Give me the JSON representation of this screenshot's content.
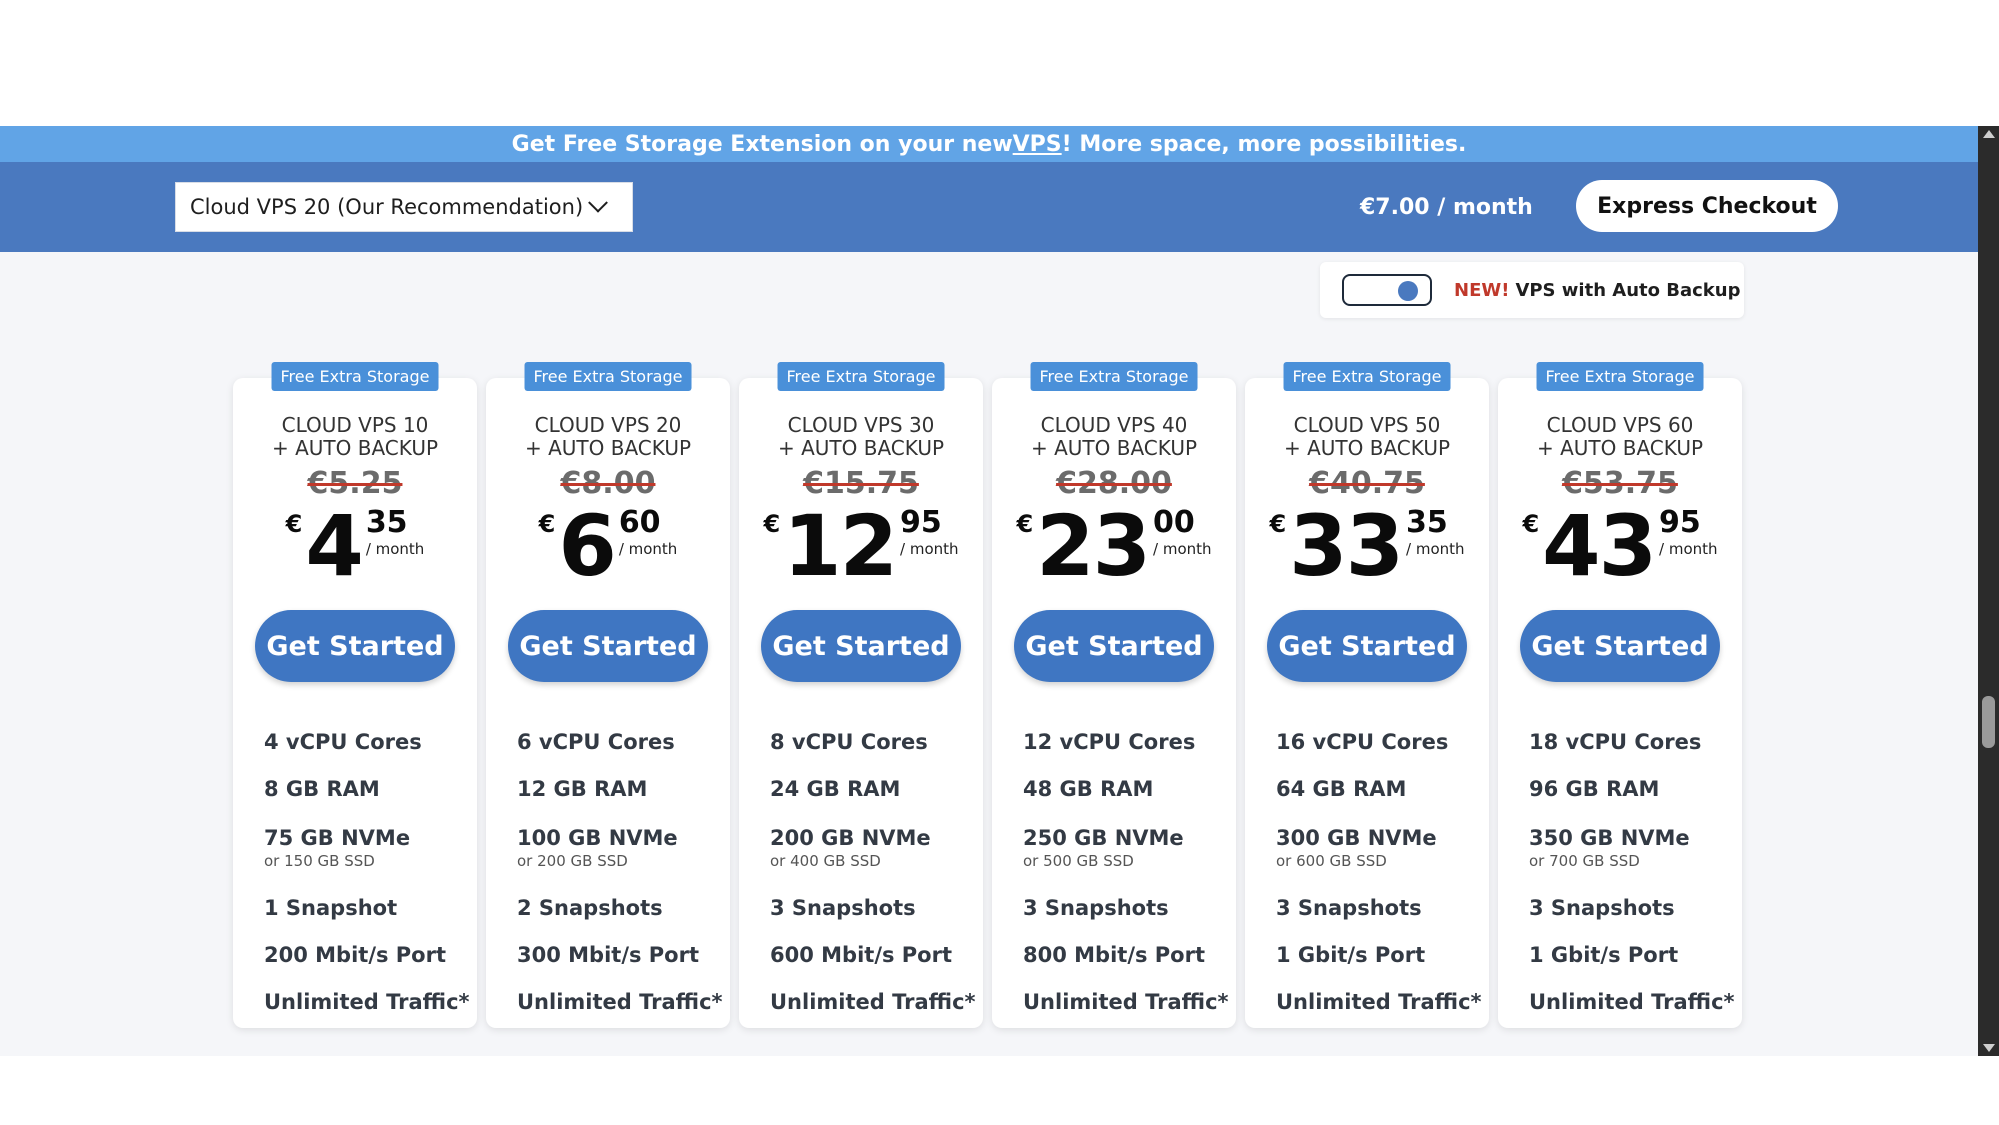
{
  "promo": {
    "text_before": "Get Free Storage Extension on your new ",
    "link_text": "VPS",
    "text_after": "! More space, more possibilities."
  },
  "selector": {
    "selected_value": "Cloud VPS 20 (Our Recommendation)",
    "price": "€7.00 / month",
    "checkout_label": "Express Checkout"
  },
  "toggle": {
    "new_label": "NEW!",
    "label": "VPS with Auto Backup",
    "state": "on"
  },
  "colors": {
    "accent": "#4a79bf",
    "promo_bg": "#61a4e6",
    "button": "#3f76c2",
    "badge": "#4a90d9",
    "strike": "#c0392b"
  },
  "plans": [
    {
      "badge": "Free Extra Storage",
      "name_line1": "CLOUD VPS 10",
      "name_line2": "+ AUTO BACKUP",
      "old_price": "€5.25",
      "currency": "€",
      "price_main": "4",
      "price_cents": "35",
      "per": "/ month",
      "cta": "Get Started",
      "cpu": "4 vCPU Cores",
      "ram": "8 GB RAM",
      "storage": "75 GB NVMe",
      "storage_alt": "or 150 GB SSD",
      "snapshots": "1 Snapshot",
      "port": "200 Mbit/s Port",
      "traffic": "Unlimited Traffic*"
    },
    {
      "badge": "Free Extra Storage",
      "name_line1": "CLOUD VPS 20",
      "name_line2": "+ AUTO BACKUP",
      "old_price": "€8.00",
      "currency": "€",
      "price_main": "6",
      "price_cents": "60",
      "per": "/ month",
      "cta": "Get Started",
      "cpu": "6 vCPU Cores",
      "ram": "12 GB RAM",
      "storage": "100 GB NVMe",
      "storage_alt": "or 200 GB SSD",
      "snapshots": "2 Snapshots",
      "port": "300 Mbit/s Port",
      "traffic": "Unlimited Traffic*"
    },
    {
      "badge": "Free Extra Storage",
      "name_line1": "CLOUD VPS 30",
      "name_line2": "+ AUTO BACKUP",
      "old_price": "€15.75",
      "currency": "€",
      "price_main": "12",
      "price_cents": "95",
      "per": "/ month",
      "cta": "Get Started",
      "cpu": "8 vCPU Cores",
      "ram": "24 GB RAM",
      "storage": "200 GB NVMe",
      "storage_alt": "or 400 GB SSD",
      "snapshots": "3 Snapshots",
      "port": "600 Mbit/s Port",
      "traffic": "Unlimited Traffic*"
    },
    {
      "badge": "Free Extra Storage",
      "name_line1": "CLOUD VPS 40",
      "name_line2": "+ AUTO BACKUP",
      "old_price": "€28.00",
      "currency": "€",
      "price_main": "23",
      "price_cents": "00",
      "per": "/ month",
      "cta": "Get Started",
      "cpu": "12 vCPU Cores",
      "ram": "48 GB RAM",
      "storage": "250 GB NVMe",
      "storage_alt": "or 500 GB SSD",
      "snapshots": "3 Snapshots",
      "port": "800 Mbit/s Port",
      "traffic": "Unlimited Traffic*"
    },
    {
      "badge": "Free Extra Storage",
      "name_line1": "CLOUD VPS 50",
      "name_line2": "+ AUTO BACKUP",
      "old_price": "€40.75",
      "currency": "€",
      "price_main": "33",
      "price_cents": "35",
      "per": "/ month",
      "cta": "Get Started",
      "cpu": "16 vCPU Cores",
      "ram": "64 GB RAM",
      "storage": "300 GB NVMe",
      "storage_alt": "or 600 GB SSD",
      "snapshots": "3 Snapshots",
      "port": "1 Gbit/s Port",
      "traffic": "Unlimited Traffic*"
    },
    {
      "badge": "Free Extra Storage",
      "name_line1": "CLOUD VPS 60",
      "name_line2": "+ AUTO BACKUP",
      "old_price": "€53.75",
      "currency": "€",
      "price_main": "43",
      "price_cents": "95",
      "per": "/ month",
      "cta": "Get Started",
      "cpu": "18 vCPU Cores",
      "ram": "96 GB RAM",
      "storage": "350 GB NVMe",
      "storage_alt": "or 700 GB SSD",
      "snapshots": "3 Snapshots",
      "port": "1 Gbit/s Port",
      "traffic": "Unlimited Traffic*"
    }
  ]
}
